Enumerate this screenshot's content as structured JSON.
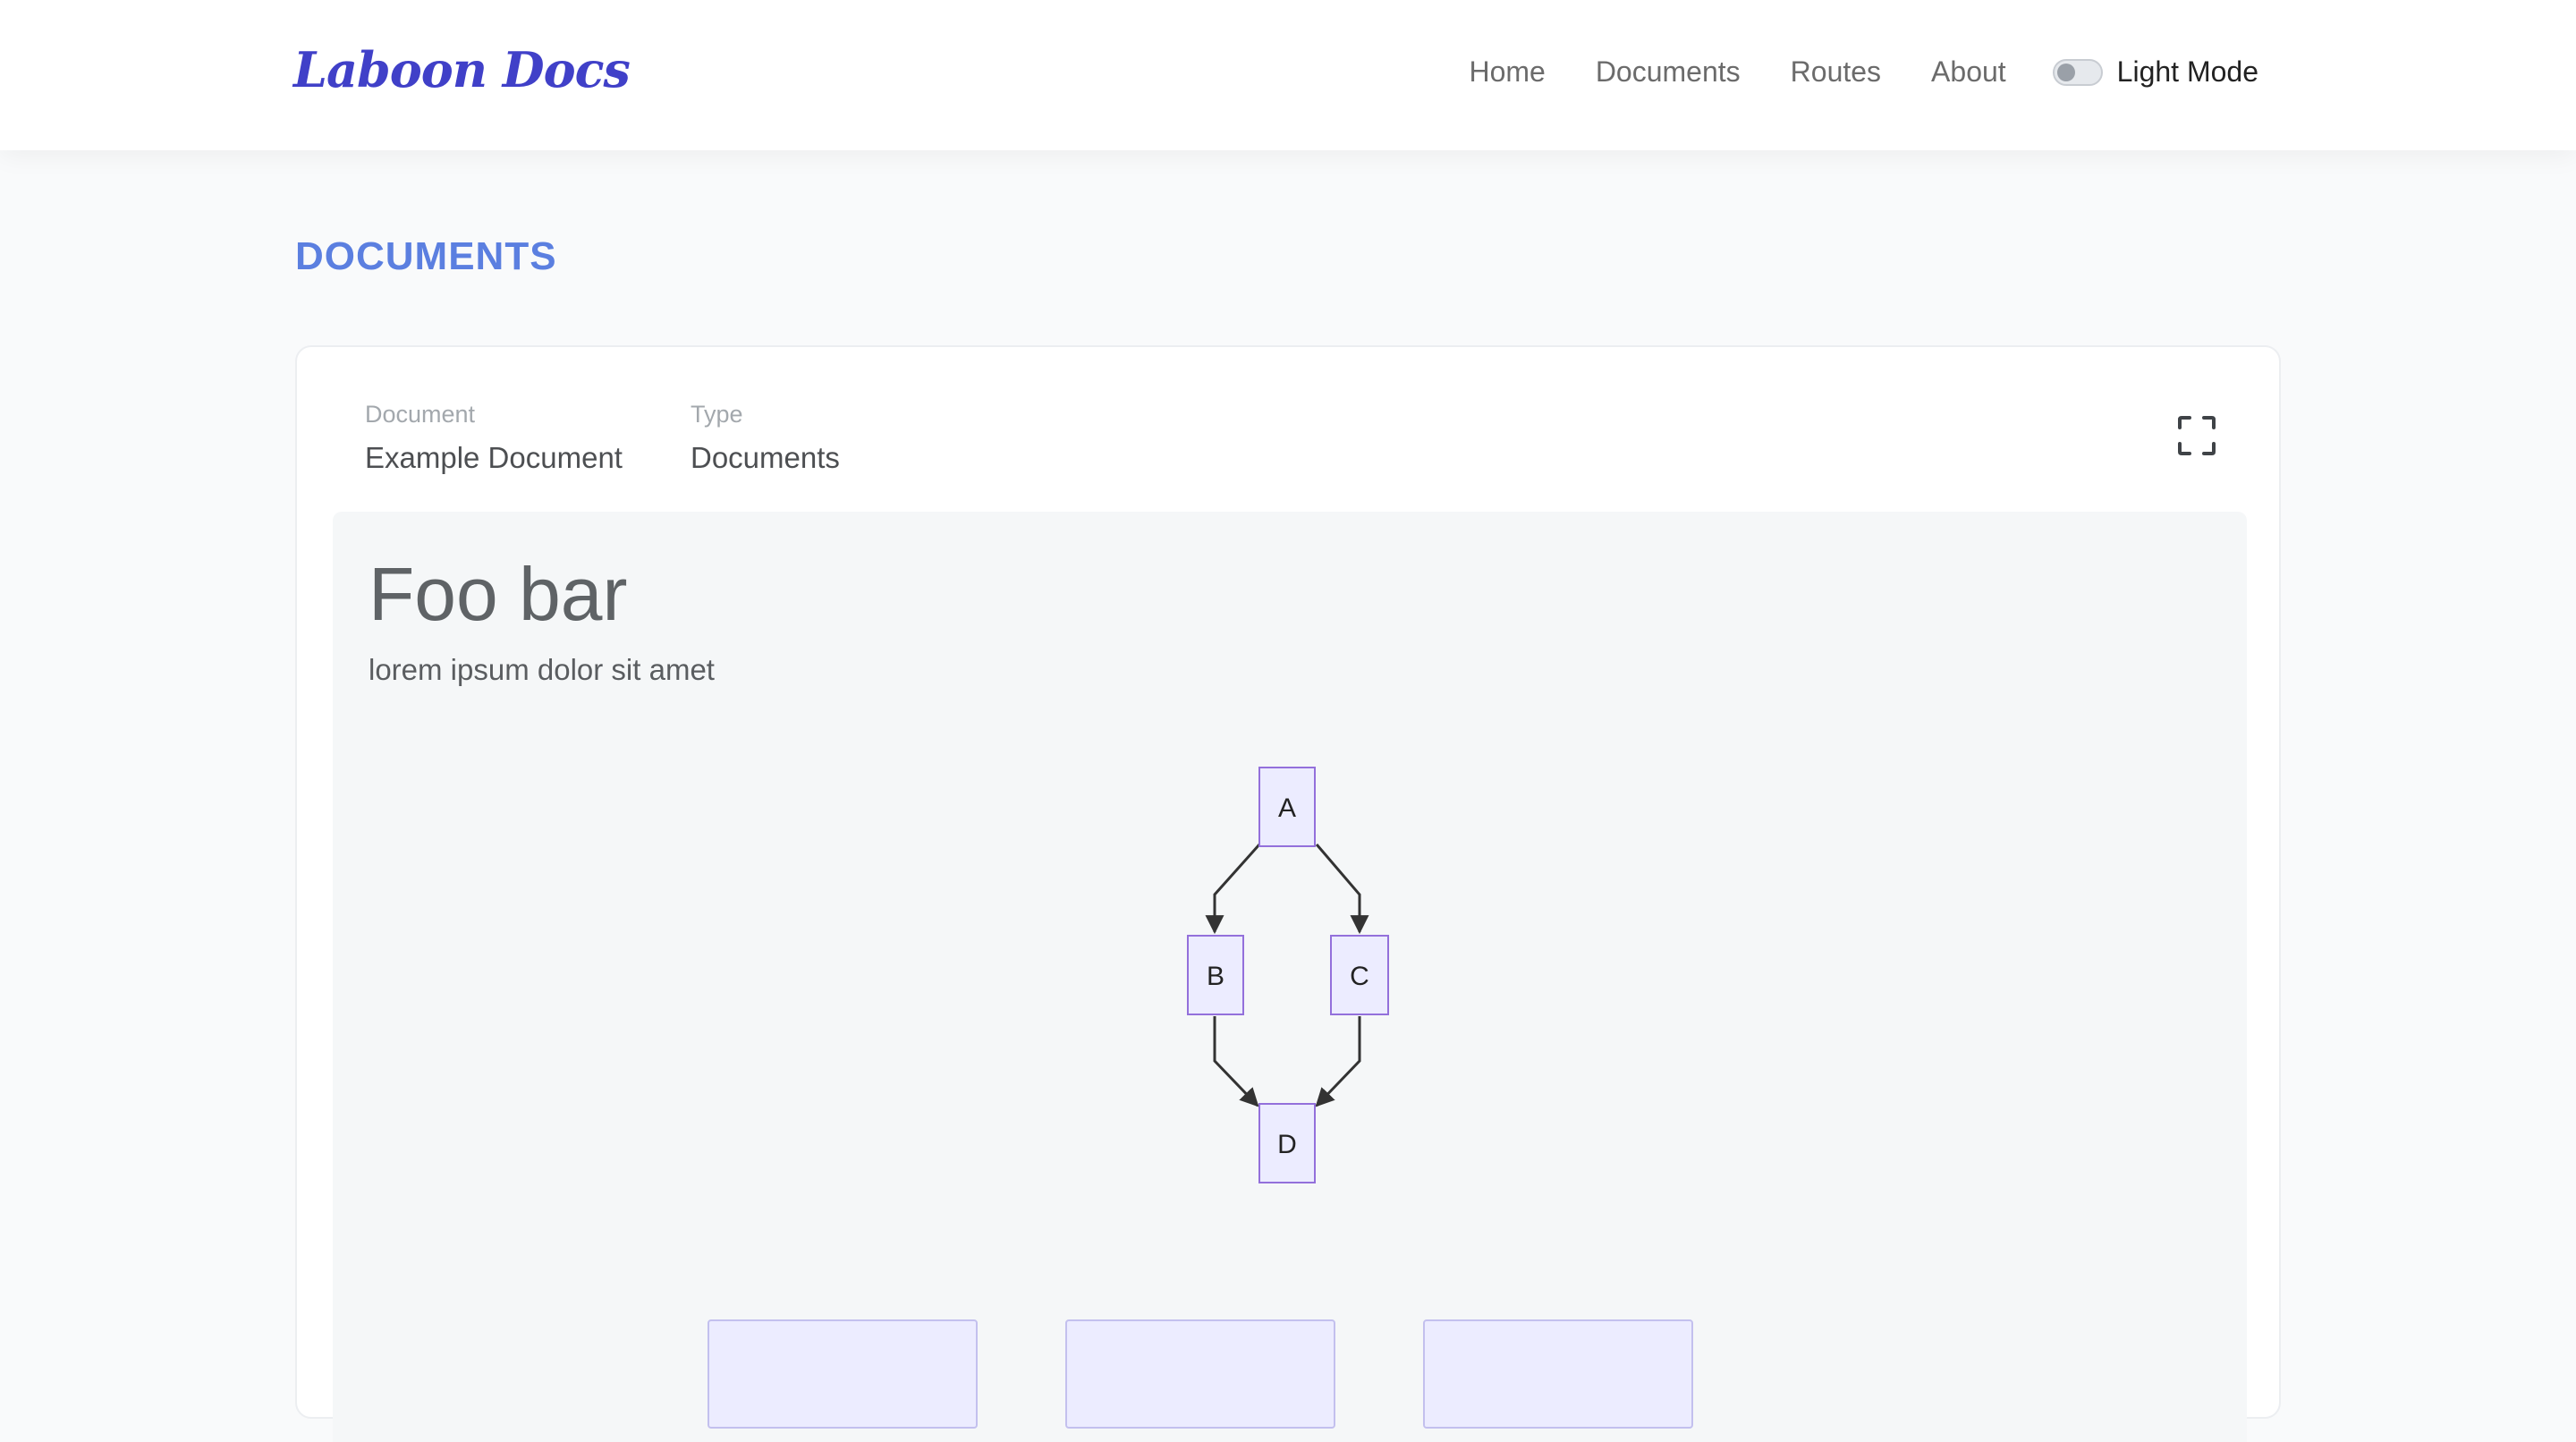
{
  "nav": {
    "logo": "Laboon Docs",
    "links": [
      "Home",
      "Documents",
      "Routes",
      "About"
    ],
    "mode_label": "Light Mode"
  },
  "page": {
    "heading": "DOCUMENTS"
  },
  "document": {
    "doc_label": "Document",
    "doc_value": "Example Document",
    "type_label": "Type",
    "type_value": "Documents",
    "title": "Foo bar",
    "body": "lorem ipsum dolor sit amet"
  },
  "diagram": {
    "nodes": [
      "A",
      "B",
      "C",
      "D"
    ],
    "edges": [
      [
        "A",
        "B"
      ],
      [
        "A",
        "C"
      ],
      [
        "B",
        "D"
      ],
      [
        "C",
        "D"
      ]
    ]
  },
  "colors": {
    "accent": "#5b7fe0",
    "logo": "#4040c8",
    "node_fill": "#ececff",
    "node_stroke": "#9370db"
  }
}
